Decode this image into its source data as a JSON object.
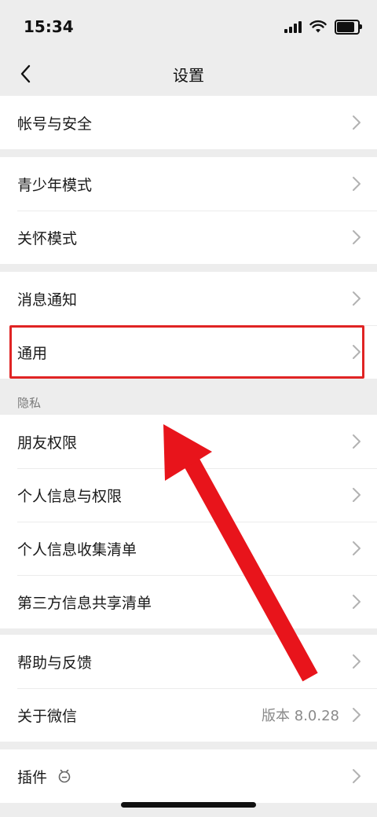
{
  "status_bar": {
    "time": "15:34"
  },
  "nav": {
    "title": "设置"
  },
  "sections": [
    {
      "items": [
        {
          "label": "帐号与安全"
        }
      ]
    },
    {
      "items": [
        {
          "label": "青少年模式"
        },
        {
          "label": "关怀模式"
        }
      ]
    },
    {
      "items": [
        {
          "label": "消息通知"
        },
        {
          "label": "通用"
        }
      ]
    },
    {
      "header": "隐私",
      "items": [
        {
          "label": "朋友权限"
        },
        {
          "label": "个人信息与权限"
        },
        {
          "label": "个人信息收集清单"
        },
        {
          "label": "第三方信息共享清单"
        }
      ]
    },
    {
      "items": [
        {
          "label": "帮助与反馈"
        },
        {
          "label": "关于微信",
          "value": "版本 8.0.28"
        }
      ]
    },
    {
      "items": [
        {
          "label": "插件",
          "icon": "plugin-icon"
        }
      ]
    }
  ],
  "annotation": {
    "highlight_color": "#e02424",
    "arrow_color": "#e8141b",
    "highlighted_item": "通用"
  },
  "colors": {
    "background": "#ededed",
    "row_background": "#ffffff",
    "secondary_text": "#8a8a8a"
  }
}
